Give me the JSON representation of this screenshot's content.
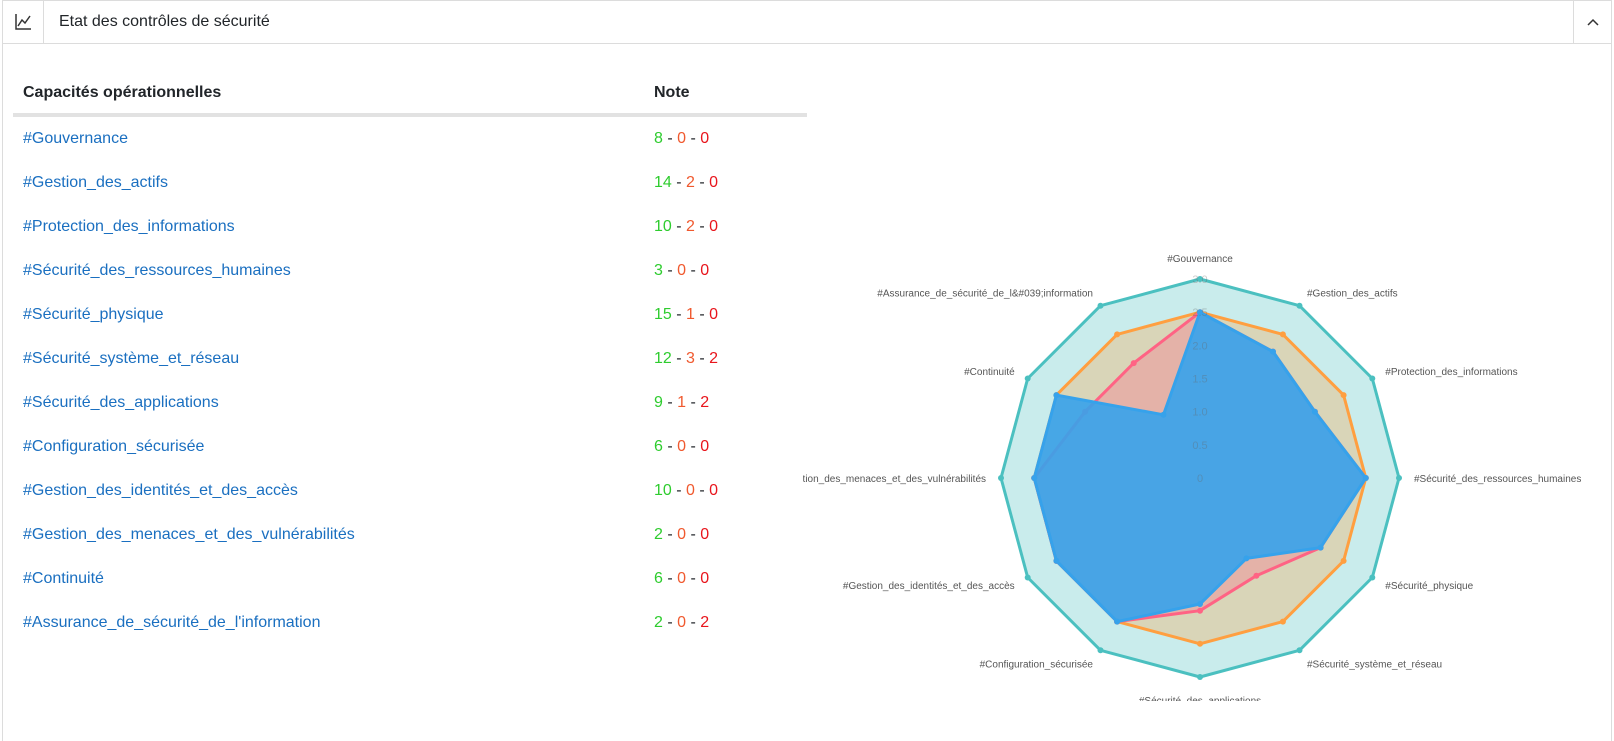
{
  "header": {
    "title": "Etat des contrôles de sécurité",
    "icon": "line-chart-icon",
    "collapse_icon": "chevron-up-icon"
  },
  "table": {
    "col_capacity": "Capacités opérationnelles",
    "col_note": "Note",
    "rows": [
      {
        "name": "#Gouvernance",
        "green": "8",
        "orange": "0",
        "red": "0"
      },
      {
        "name": "#Gestion_des_actifs",
        "green": "14",
        "orange": "2",
        "red": "0"
      },
      {
        "name": "#Protection_des_informations",
        "green": "10",
        "orange": "2",
        "red": "0"
      },
      {
        "name": "#Sécurité_des_ressources_humaines",
        "green": "3",
        "orange": "0",
        "red": "0"
      },
      {
        "name": "#Sécurité_physique",
        "green": "15",
        "orange": "1",
        "red": "0"
      },
      {
        "name": "#Sécurité_système_et_réseau",
        "green": "12",
        "orange": "3",
        "red": "2"
      },
      {
        "name": "#Sécurité_des_applications",
        "green": "9",
        "orange": "1",
        "red": "2"
      },
      {
        "name": "#Configuration_sécurisée",
        "green": "6",
        "orange": "0",
        "red": "0"
      },
      {
        "name": "#Gestion_des_identités_et_des_accès",
        "green": "10",
        "orange": "0",
        "red": "0"
      },
      {
        "name": "#Gestion_des_menaces_et_des_vulnérabilités",
        "green": "2",
        "orange": "0",
        "red": "0"
      },
      {
        "name": "#Continuité",
        "green": "6",
        "orange": "0",
        "red": "0"
      },
      {
        "name": "#Assurance_de_sécurité_de_l'information",
        "green": "2",
        "orange": "0",
        "red": "2"
      }
    ]
  },
  "colors": {
    "green": "#2ecc2e",
    "orange": "#f0592e",
    "red": "#e8151c",
    "link": "#1a6fc0",
    "series_teal": "#4bc0c0",
    "series_orange": "#ff9f40",
    "series_pink": "#ff6384",
    "series_blue": "#36a2eb"
  },
  "chart_data": {
    "type": "radar",
    "labels": [
      "#Gouvernance",
      "#Gestion_des_actifs",
      "#Protection_des_informations",
      "#Sécurité_des_ressources_humaines",
      "#Sécurité_physique",
      "#Sécurité_système_et_réseau",
      "#Sécurité_des_applications",
      "#Configuration_sécurisée",
      "#Gestion_des_identités_et_des_accès",
      "#Gestion_des_menaces_et_des_vulnérabilités",
      "#Continuité",
      "#Assurance_de_sécurité_de_l&#039;information"
    ],
    "r_range": [
      0,
      3.0
    ],
    "r_ticks": [
      "3.0",
      "2.5",
      "2.0",
      "1.5",
      "1.0",
      "0.5",
      "0"
    ],
    "series": [
      {
        "color": "#4bc0c0",
        "fill": "rgba(75,192,192,0.3)",
        "values": [
          3,
          3,
          3,
          3,
          3,
          3,
          3,
          3,
          3,
          3,
          3,
          3
        ]
      },
      {
        "color": "#ff9f40",
        "fill": "rgba(255,159,64,0.3)",
        "values": [
          2.5,
          2.5,
          2.5,
          2.5,
          2.5,
          2.5,
          2.5,
          2.5,
          2.5,
          2.5,
          2.5,
          2.5
        ]
      },
      {
        "color": "#ff6384",
        "fill": "rgba(255,99,132,0.3)",
        "values": [
          2.5,
          2.2,
          2.0,
          2.5,
          2.1,
          1.7,
          2.0,
          2.5,
          2.5,
          2.5,
          2.0,
          2.0
        ]
      },
      {
        "color": "#36a2eb",
        "fill": "rgba(54,162,235,0.9)",
        "values": [
          2.5,
          2.2,
          2.0,
          2.5,
          2.1,
          1.4,
          1.9,
          2.5,
          2.5,
          2.5,
          2.5,
          1.1
        ]
      }
    ]
  }
}
